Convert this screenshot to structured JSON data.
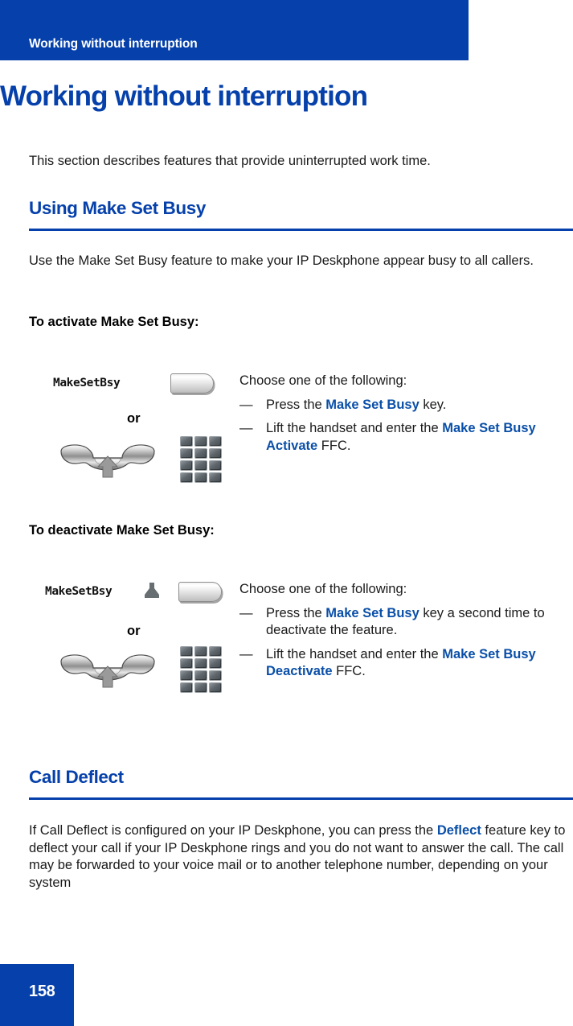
{
  "colors": {
    "brand_blue": "#0540ab",
    "link_blue": "#0a4fa8",
    "body_text": "#1a1a1a",
    "banner_text": "#ffffff",
    "key_gray": "#5f676c"
  },
  "header": {
    "running_title": "Working without interruption"
  },
  "chapter": {
    "title": "Working without interruption",
    "intro": "This section describes features that provide uninterrupted work time."
  },
  "sections": [
    {
      "heading": "Using Make Set Busy",
      "body": "Use the Make Set Busy feature to make your IP Deskphone appear busy to all callers."
    },
    {
      "heading": "Call Deflect",
      "body_parts": {
        "p1": "If Call Deflect is configured on your IP Deskphone, you can press the ",
        "kw1": "Deflect",
        "p2": " feature key to deflect your call if your IP Deskphone rings and you do not want to answer the call. The call may be forwarded to your voice mail or to another telephone number, depending on your system"
      }
    }
  ],
  "procedures": [
    {
      "title": "To activate Make Set Busy:",
      "art": {
        "lcd_label": "MakeSetBsy",
        "or_label": "or",
        "has_led_indicator": false,
        "feature_key_name": "make-set-busy-feature-key",
        "handset_name": "lift-handset-icon",
        "keypad_name": "dialpad-icon"
      },
      "lead": "Choose one of the following:",
      "steps": [
        {
          "dash": "—",
          "parts": [
            {
              "text": "Press the ",
              "emphasis": false
            },
            {
              "text": "Make Set Busy",
              "emphasis": true
            },
            {
              "text": " key.",
              "emphasis": false
            }
          ]
        },
        {
          "dash": "—",
          "parts": [
            {
              "text": "Lift the handset and enter the ",
              "emphasis": false
            },
            {
              "text": "Make Set Busy Activate",
              "emphasis": true
            },
            {
              "text": " FFC.",
              "emphasis": false
            }
          ]
        }
      ]
    },
    {
      "title": "To deactivate Make Set Busy:",
      "art": {
        "lcd_label": "MakeSetBsy",
        "or_label": "or",
        "has_led_indicator": true,
        "feature_key_name": "make-set-busy-feature-key",
        "handset_name": "lift-handset-icon",
        "keypad_name": "dialpad-icon"
      },
      "lead": "Choose one of the following:",
      "steps": [
        {
          "dash": "—",
          "parts": [
            {
              "text": "Press the ",
              "emphasis": false
            },
            {
              "text": "Make Set Busy",
              "emphasis": true
            },
            {
              "text": " key a second time to deactivate the feature.",
              "emphasis": false
            }
          ]
        },
        {
          "dash": "—",
          "parts": [
            {
              "text": "Lift the handset and enter the ",
              "emphasis": false
            },
            {
              "text": "Make Set Busy Deactivate",
              "emphasis": true
            },
            {
              "text": " FFC.",
              "emphasis": false
            }
          ]
        }
      ]
    }
  ],
  "footer": {
    "page_number": "158"
  }
}
